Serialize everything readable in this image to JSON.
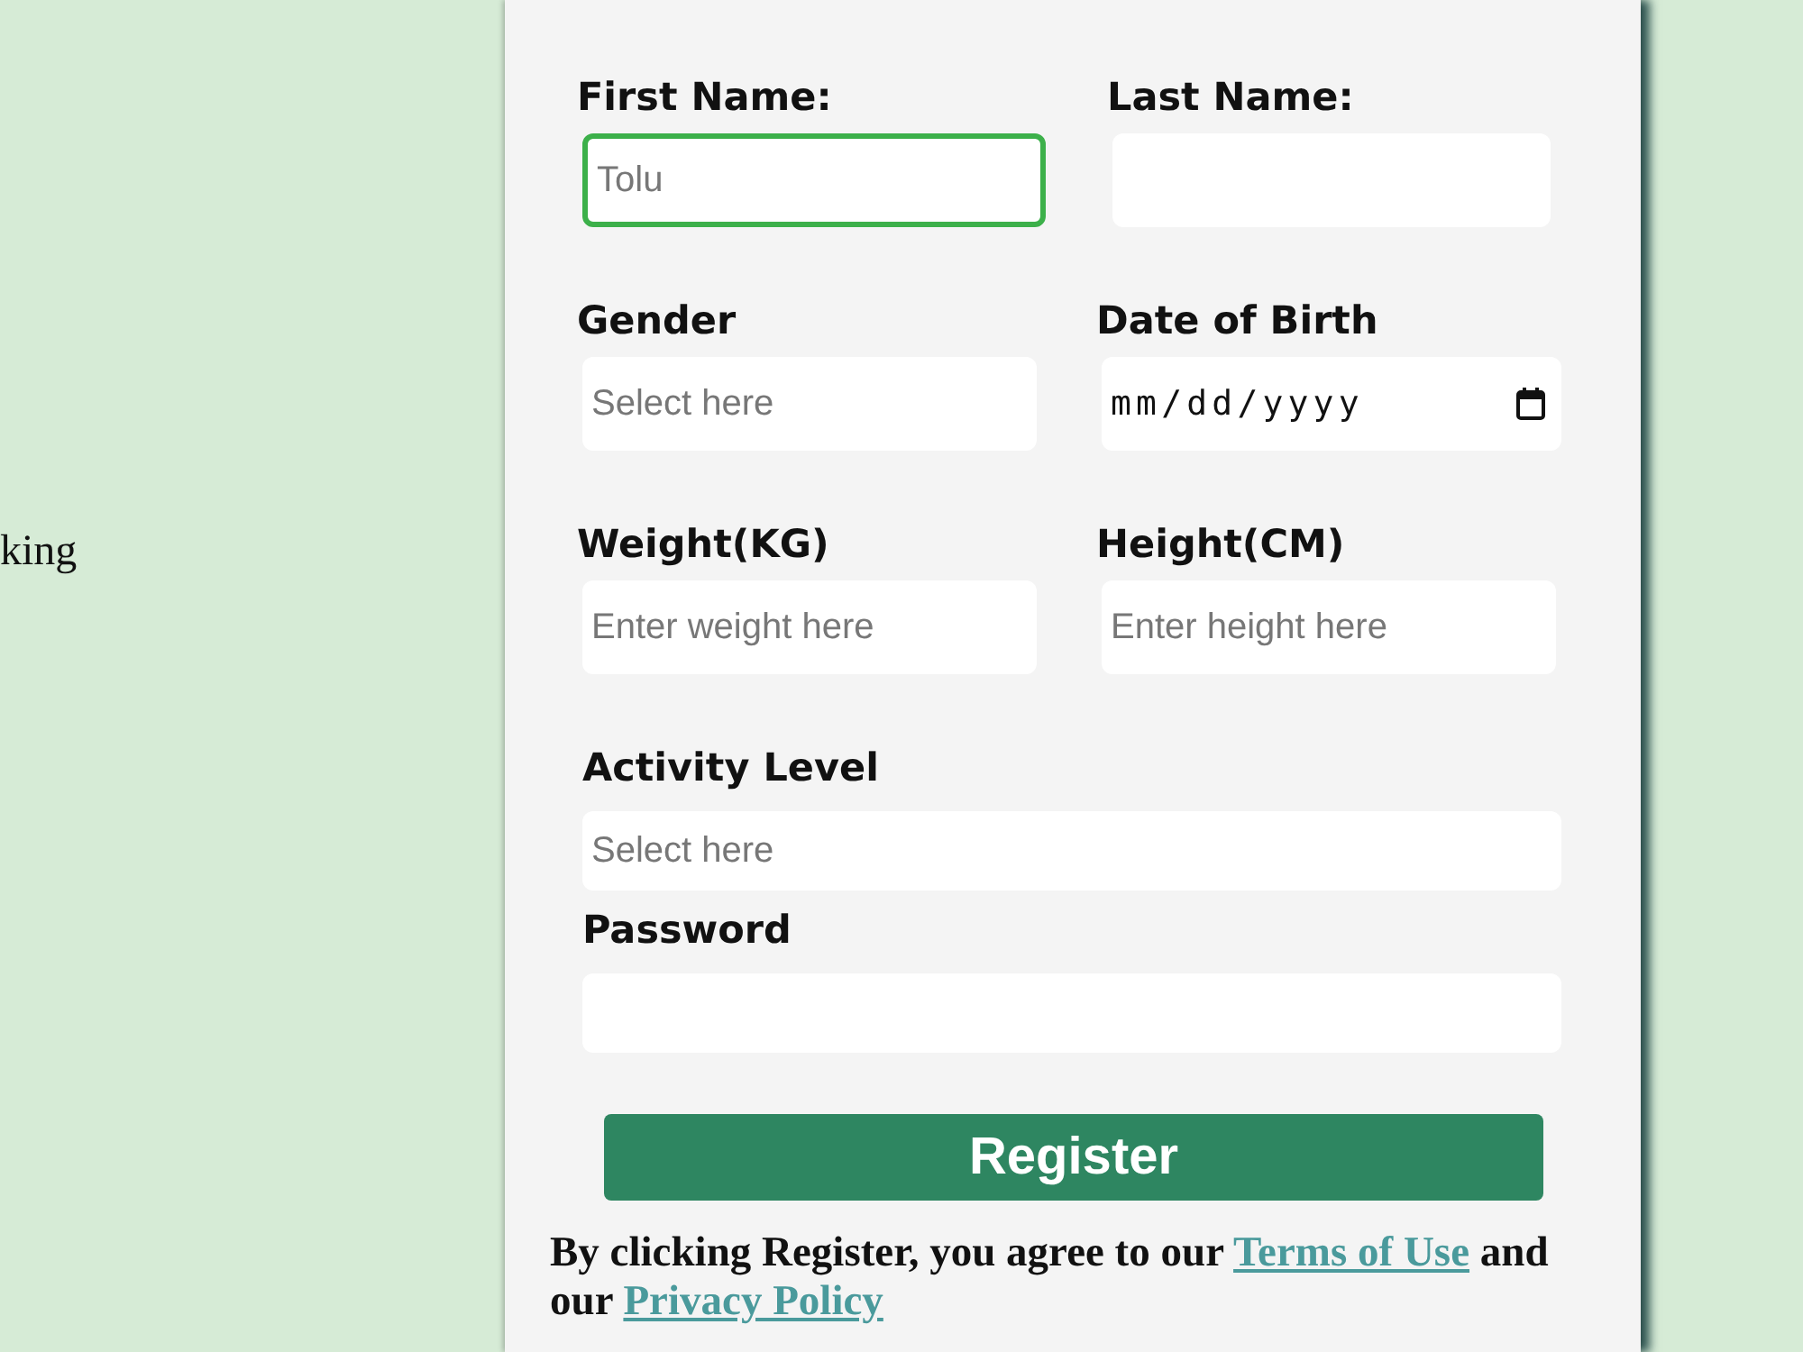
{
  "side_text": "king",
  "form": {
    "rows": [
      [
        {
          "label": "First Name:",
          "kind": "text",
          "placeholder": "Tolu",
          "focused": true
        },
        {
          "label": "Last Name:",
          "kind": "text",
          "focused": false
        }
      ],
      [
        {
          "label": "Gender",
          "kind": "text",
          "placeholder": "Select here",
          "focused": false
        },
        {
          "label": "Date of Birth",
          "kind": "date",
          "value": "mm/dd/yyyy",
          "focused": false
        }
      ],
      [
        {
          "label": "Weight(KG)",
          "kind": "text",
          "placeholder": "Enter weight here",
          "focused": false
        },
        {
          "label": "Height(CM)",
          "kind": "text",
          "placeholder": "Enter height here",
          "focused": false
        }
      ],
      [
        {
          "label": "Activity Level",
          "kind": "text",
          "placeholder": "Select here",
          "focused": false
        }
      ],
      [
        {
          "label": "Password",
          "kind": "text",
          "focused": false
        }
      ]
    ],
    "register_button": "Register",
    "terms": {
      "text_before": "By clicking Register, you agree to our",
      "terms_link": "Terms of Use",
      "text_middle": "and our",
      "privacy_link": "Privacy Policy"
    }
  }
}
